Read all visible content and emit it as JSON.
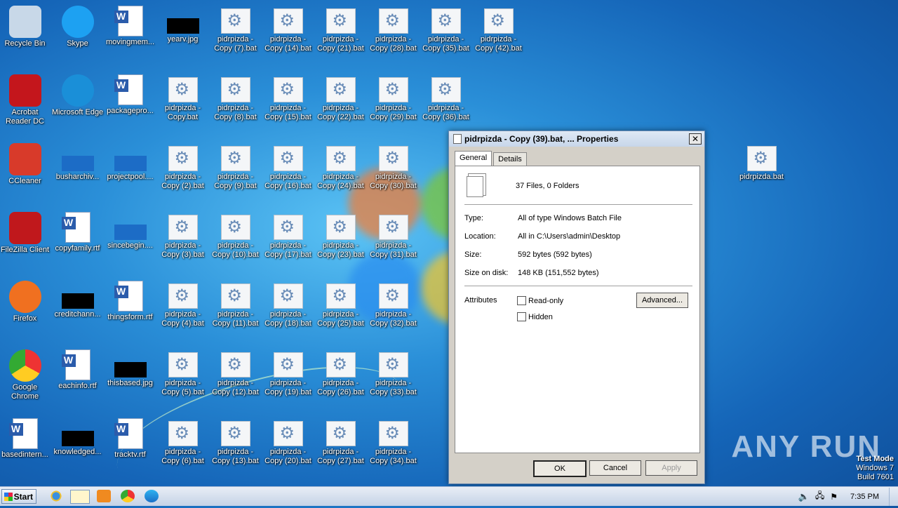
{
  "desktop_icons": [
    {
      "label": "Recycle Bin",
      "icon": "recycle-bin-icon",
      "kind": "app"
    },
    {
      "label": "Skype",
      "icon": "skype-icon",
      "kind": "app"
    },
    {
      "label": "movingmem...",
      "icon": "word-doc-icon",
      "kind": "doc"
    },
    {
      "label": "yearv.jpg",
      "icon": "image-file-icon",
      "kind": "blk"
    },
    {
      "label": "pidrpizda -\nCopy (7).bat"
    },
    {
      "label": "pidrpizda -\nCopy (14).bat"
    },
    {
      "label": "pidrpizda -\nCopy (21).bat"
    },
    {
      "label": "pidrpizda -\nCopy (28).bat"
    },
    {
      "label": "pidrpizda -\nCopy (35).bat"
    },
    {
      "label": "pidrpizda -\nCopy (42).bat"
    },
    {
      "label": "Acrobat\nReader DC",
      "icon": "acrobat-icon",
      "kind": "app"
    },
    {
      "label": "Microsoft Edge",
      "icon": "edge-icon",
      "kind": "app"
    },
    {
      "label": "packagepro...",
      "icon": "word-doc-icon",
      "kind": "doc"
    },
    {
      "label": "pidrpizda -\nCopy.bat"
    },
    {
      "label": "pidrpizda -\nCopy (8).bat"
    },
    {
      "label": "pidrpizda -\nCopy (15).bat"
    },
    {
      "label": "pidrpizda -\nCopy (22).bat"
    },
    {
      "label": "pidrpizda -\nCopy (29).bat"
    },
    {
      "label": "pidrpizda -\nCopy (36).bat"
    },
    {
      "label": "CCleaner",
      "icon": "ccleaner-icon",
      "kind": "app"
    },
    {
      "label": "busharchiv...",
      "icon": "file-icon",
      "kind": "blue"
    },
    {
      "label": "projectpool....",
      "icon": "file-icon",
      "kind": "blue"
    },
    {
      "label": "pidrpizda -\nCopy (2).bat"
    },
    {
      "label": "pidrpizda -\nCopy (9).bat"
    },
    {
      "label": "pidrpizda -\nCopy (16).bat"
    },
    {
      "label": "pidrpizda -\nCopy (24).bat"
    },
    {
      "label": "pidrpizda -\nCopy (30).bat"
    },
    {
      "label": "FileZilla Client",
      "icon": "filezilla-icon",
      "kind": "app"
    },
    {
      "label": "copyfamily.rtf",
      "icon": "word-doc-icon",
      "kind": "doc"
    },
    {
      "label": "sincebegin....",
      "icon": "file-icon",
      "kind": "blue"
    },
    {
      "label": "pidrpizda -\nCopy (3).bat"
    },
    {
      "label": "pidrpizda -\nCopy (10).bat"
    },
    {
      "label": "pidrpizda -\nCopy (17).bat"
    },
    {
      "label": "pidrpizda -\nCopy (23).bat"
    },
    {
      "label": "pidrpizda -\nCopy (31).bat"
    },
    {
      "label": "Firefox",
      "icon": "firefox-icon",
      "kind": "app"
    },
    {
      "label": "creditchann...",
      "icon": "image-file-icon",
      "kind": "blk"
    },
    {
      "label": "thingsform.rtf",
      "icon": "word-doc-icon",
      "kind": "doc"
    },
    {
      "label": "pidrpizda -\nCopy (4).bat"
    },
    {
      "label": "pidrpizda -\nCopy (11).bat"
    },
    {
      "label": "pidrpizda -\nCopy (18).bat"
    },
    {
      "label": "pidrpizda -\nCopy (25).bat"
    },
    {
      "label": "pidrpizda -\nCopy (32).bat"
    },
    {
      "label": "Google\nChrome",
      "icon": "chrome-icon",
      "kind": "app"
    },
    {
      "label": "eachinfo.rtf",
      "icon": "word-doc-icon",
      "kind": "doc"
    },
    {
      "label": "thisbased.jpg",
      "icon": "image-file-icon",
      "kind": "blk"
    },
    {
      "label": "pidrpizda -\nCopy (5).bat"
    },
    {
      "label": "pidrpizda -\nCopy (12).bat"
    },
    {
      "label": "pidrpizda -\nCopy (19).bat"
    },
    {
      "label": "pidrpizda -\nCopy (26).bat"
    },
    {
      "label": "pidrpizda -\nCopy (33).bat"
    },
    {
      "label": "basedintern...",
      "icon": "word-doc-icon",
      "kind": "doc"
    },
    {
      "label": "knowledged...",
      "icon": "image-file-icon",
      "kind": "blk"
    },
    {
      "label": "tracktv.rtf",
      "icon": "word-doc-icon",
      "kind": "doc"
    },
    {
      "label": "pidrpizda -\nCopy (6).bat"
    },
    {
      "label": "pidrpizda -\nCopy (13).bat"
    },
    {
      "label": "pidrpizda -\nCopy (20).bat"
    },
    {
      "label": "pidrpizda -\nCopy (27).bat"
    },
    {
      "label": "pidrpizda -\nCopy (34).bat"
    },
    {
      "label": "pidrpizda.bat"
    }
  ],
  "dialog": {
    "title": "pidrpizda - Copy (39).bat, ... Properties",
    "tabs": [
      "General",
      "Details"
    ],
    "summary": "37 Files, 0 Folders",
    "type_label": "Type:",
    "type_value": "All of type Windows Batch File",
    "location_label": "Location:",
    "location_value": "All in C:\\Users\\admin\\Desktop",
    "size_label": "Size:",
    "size_value": "592 bytes (592 bytes)",
    "size_on_disk_label": "Size on disk:",
    "size_on_disk_value": "148 KB (151,552 bytes)",
    "attributes_label": "Attributes",
    "readonly_label": "Read-only",
    "hidden_label": "Hidden",
    "advanced_label": "Advanced...",
    "ok_label": "OK",
    "cancel_label": "Cancel",
    "apply_label": "Apply"
  },
  "taskbar": {
    "start_label": "Start",
    "clock": "7:35 PM"
  },
  "watermark": "ANY RUN",
  "test_mode": {
    "line1": "Test Mode",
    "line2": "Windows 7",
    "line3": "Build 7601"
  }
}
